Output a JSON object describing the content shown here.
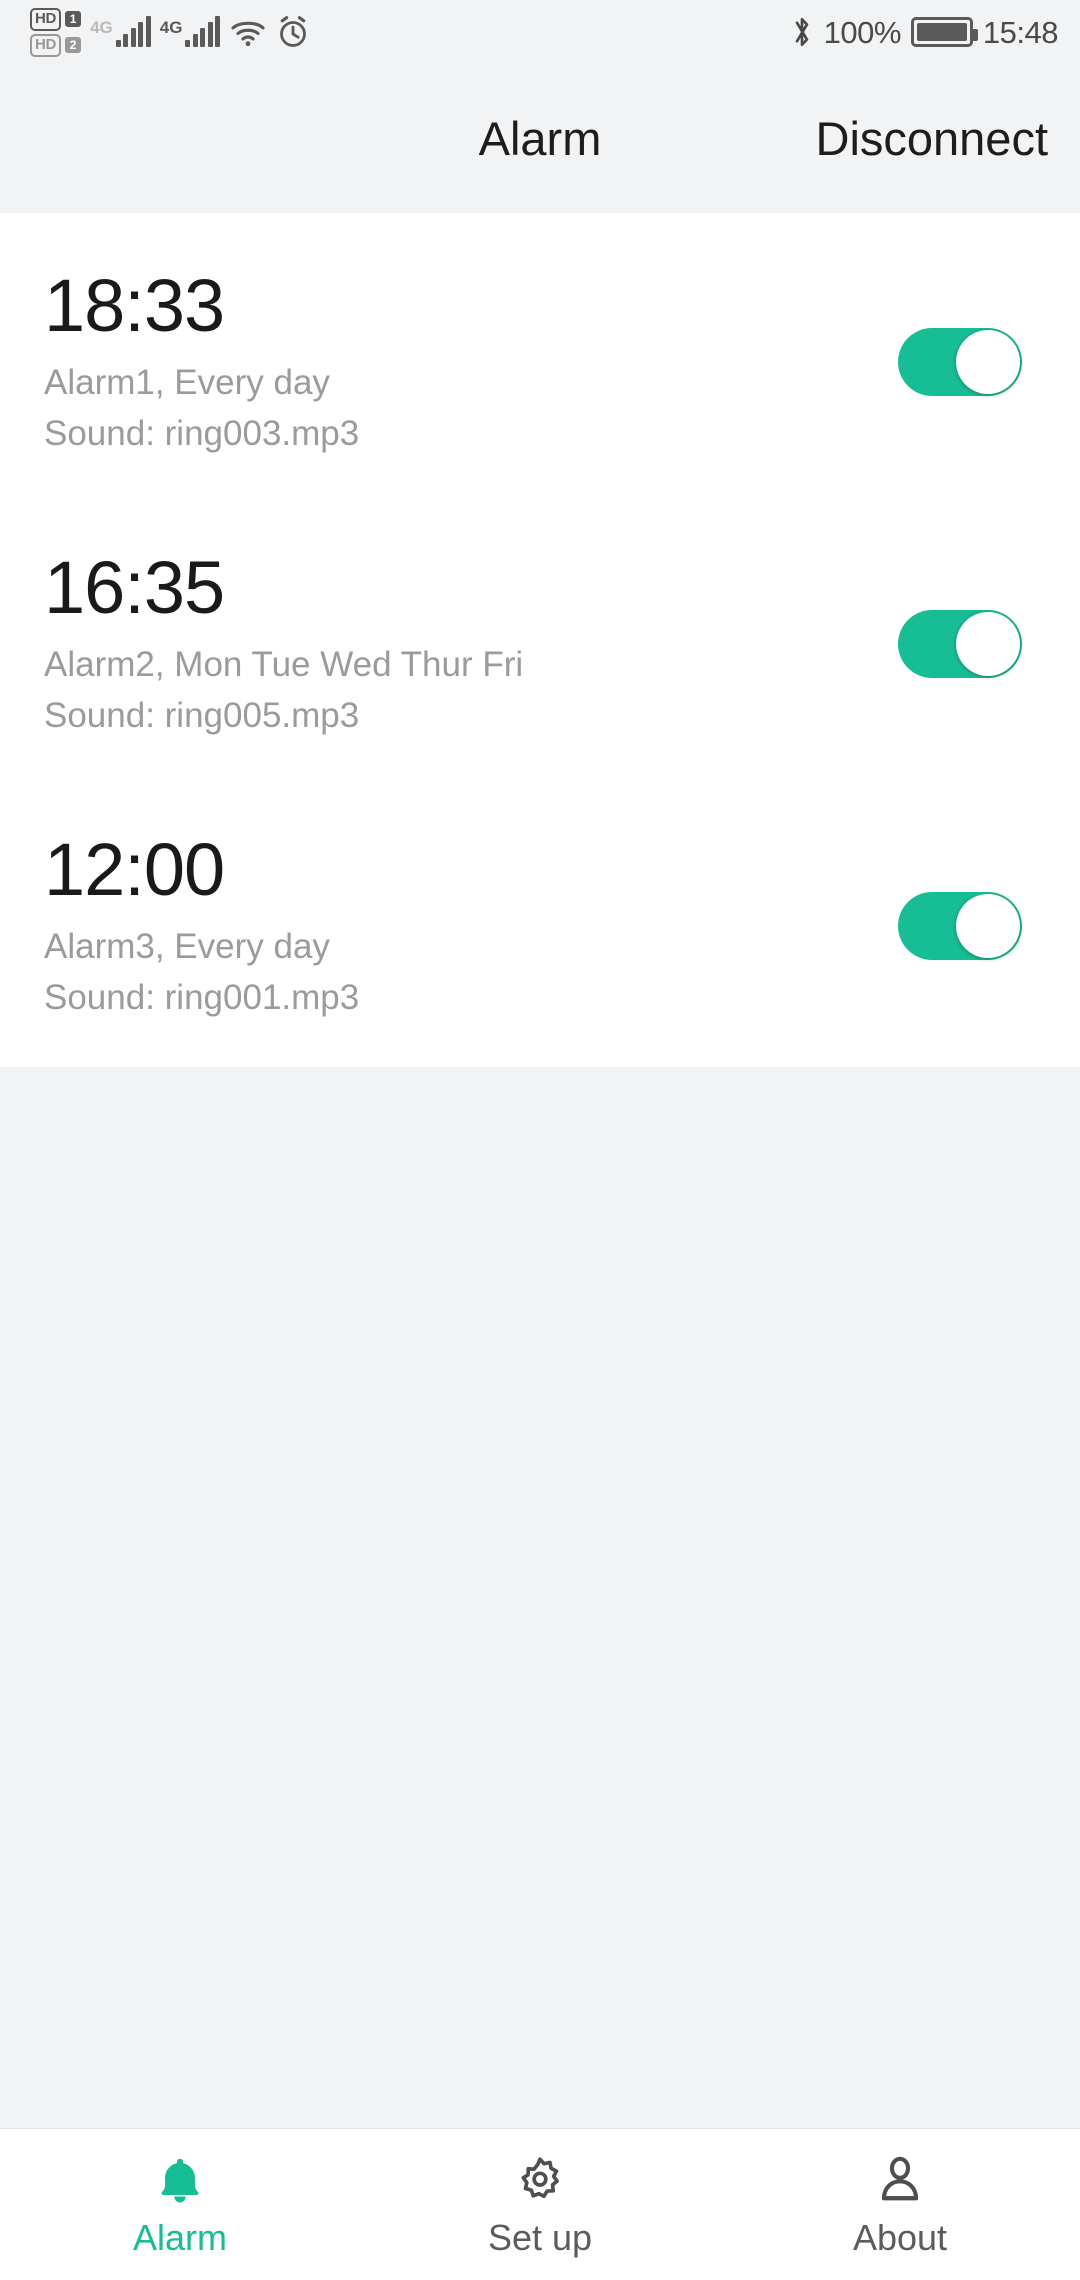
{
  "statusbar": {
    "hd_badges": [
      {
        "label": "HD",
        "sim": "1"
      },
      {
        "label": "HD",
        "sim": "2"
      }
    ],
    "networks": [
      {
        "label": "4G",
        "bars": 5
      },
      {
        "label": "4G",
        "bars": 5
      }
    ],
    "wifi_icon": "wifi-icon",
    "alarm_clock_icon": "alarm-clock-icon",
    "bluetooth_icon": "bluetooth-icon",
    "battery_percent": "100%",
    "battery_icon": "battery-full-icon",
    "time": "15:48"
  },
  "header": {
    "title": "Alarm",
    "action_label": "Disconnect"
  },
  "alarms": [
    {
      "time": "18:33",
      "meta": "Alarm1, Every day",
      "sound": "Sound: ring003.mp3",
      "enabled": true
    },
    {
      "time": "16:35",
      "meta": "Alarm2, Mon Tue Wed Thur Fri",
      "sound": "Sound: ring005.mp3",
      "enabled": true
    },
    {
      "time": "12:00",
      "meta": "Alarm3, Every day",
      "sound": "Sound: ring001.mp3",
      "enabled": true
    }
  ],
  "bottom_nav": {
    "items": [
      {
        "label": "Alarm",
        "icon": "bell-icon",
        "active": true
      },
      {
        "label": "Set up",
        "icon": "gear-icon",
        "active": false
      },
      {
        "label": "About",
        "icon": "person-icon",
        "active": false
      }
    ]
  },
  "colors": {
    "accent": "#17bd95",
    "page_background": "#f2f3f4",
    "list_background": "#ffffff",
    "primary_text": "#1a1a1a",
    "secondary_text": "#9b9b9b"
  }
}
